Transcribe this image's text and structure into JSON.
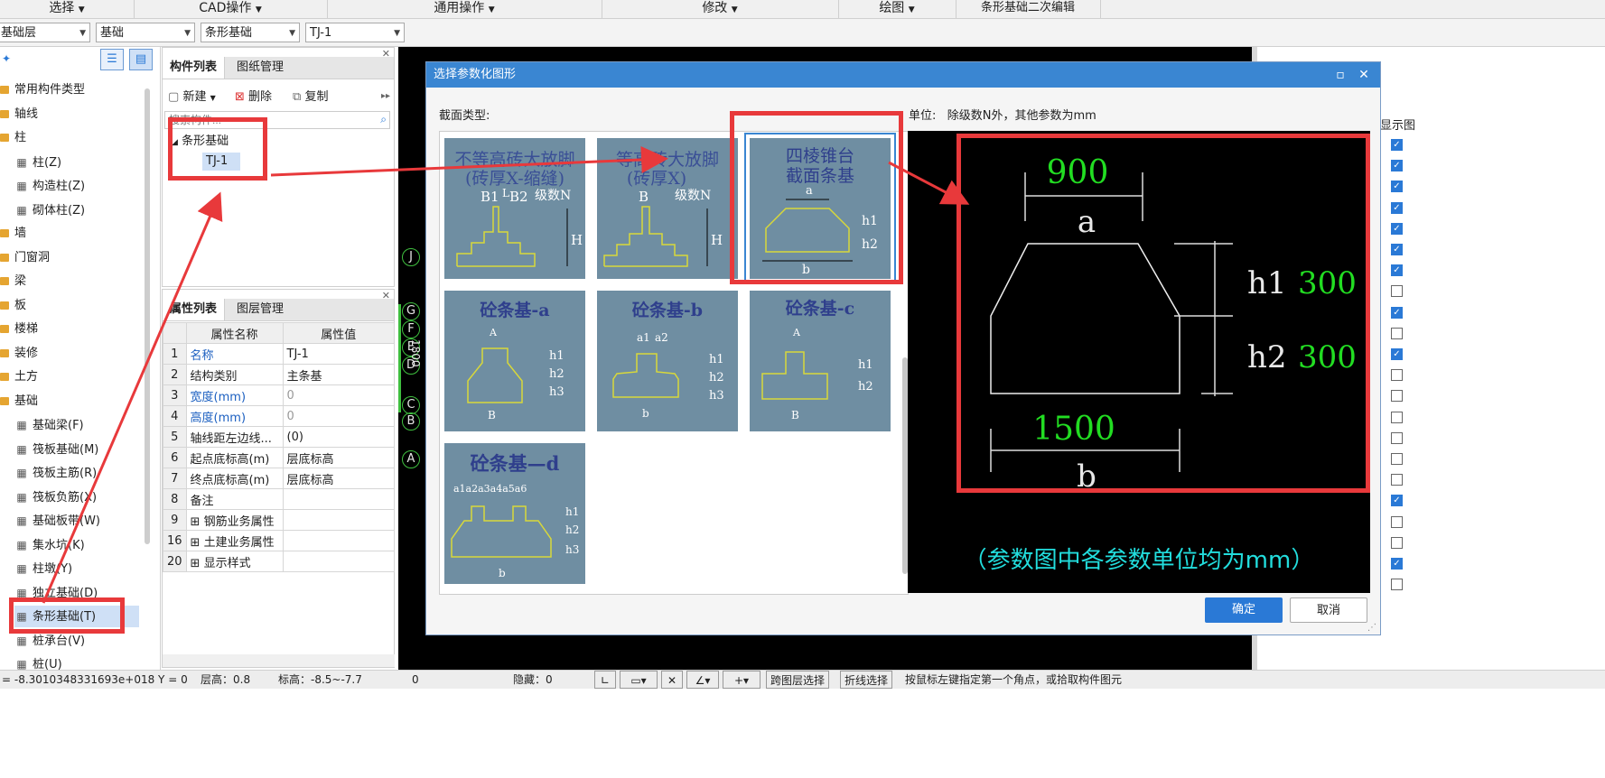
{
  "menu": {
    "items": [
      "选择",
      "CAD操作",
      "通用操作",
      "修改",
      "绘图",
      "条形基础二次编辑"
    ]
  },
  "selectors": {
    "floor": "基础层",
    "category": "基础",
    "type": "条形基础",
    "component": "TJ-1"
  },
  "tree": {
    "items": [
      {
        "label": "常用构件类型",
        "kind": "folder"
      },
      {
        "label": "轴线",
        "kind": "folder"
      },
      {
        "label": "柱",
        "kind": "folder"
      },
      {
        "label": "柱(Z)",
        "kind": "child"
      },
      {
        "label": "构造柱(Z)",
        "kind": "child"
      },
      {
        "label": "砌体柱(Z)",
        "kind": "child"
      },
      {
        "label": "墙",
        "kind": "folder"
      },
      {
        "label": "门窗洞",
        "kind": "folder"
      },
      {
        "label": "梁",
        "kind": "folder"
      },
      {
        "label": "板",
        "kind": "folder"
      },
      {
        "label": "楼梯",
        "kind": "folder"
      },
      {
        "label": "装修",
        "kind": "folder"
      },
      {
        "label": "土方",
        "kind": "folder"
      },
      {
        "label": "基础",
        "kind": "folder"
      },
      {
        "label": "基础梁(F)",
        "kind": "child"
      },
      {
        "label": "筏板基础(M)",
        "kind": "child"
      },
      {
        "label": "筏板主筋(R)",
        "kind": "child"
      },
      {
        "label": "筏板负筋(X)",
        "kind": "child"
      },
      {
        "label": "基础板带(W)",
        "kind": "child"
      },
      {
        "label": "集水坑(K)",
        "kind": "child"
      },
      {
        "label": "柱墩(Y)",
        "kind": "child"
      },
      {
        "label": "独立基础(D)",
        "kind": "child"
      },
      {
        "label": "条形基础(T)",
        "kind": "child"
      },
      {
        "label": "桩承台(V)",
        "kind": "child"
      },
      {
        "label": "桩(U)",
        "kind": "child"
      }
    ]
  },
  "component_panel": {
    "tabs": [
      "构件列表",
      "图纸管理"
    ],
    "new_label": "新建",
    "delete_label": "删除",
    "copy_label": "复制",
    "search_placeholder": "搜索构件...",
    "group": "条形基础",
    "item": "TJ-1"
  },
  "property_panel": {
    "tabs": [
      "属性列表",
      "图层管理"
    ],
    "headers": [
      "属性名称",
      "属性值"
    ],
    "rows": [
      {
        "num": "1",
        "name": "名称",
        "value": "TJ-1",
        "name_blue": true,
        "value_gray": false,
        "expand": false
      },
      {
        "num": "2",
        "name": "结构类别",
        "value": "主条基",
        "name_blue": false,
        "value_gray": false,
        "expand": false
      },
      {
        "num": "3",
        "name": "宽度(mm)",
        "value": "0",
        "name_blue": true,
        "value_gray": true,
        "expand": false
      },
      {
        "num": "4",
        "name": "高度(mm)",
        "value": "0",
        "name_blue": true,
        "value_gray": true,
        "expand": false
      },
      {
        "num": "5",
        "name": "轴线距左边线...",
        "value": "(0)",
        "name_blue": false,
        "value_gray": false,
        "expand": false
      },
      {
        "num": "6",
        "name": "起点底标高(m)",
        "value": "层底标高",
        "name_blue": false,
        "value_gray": false,
        "expand": false
      },
      {
        "num": "7",
        "name": "终点底标高(m)",
        "value": "层底标高",
        "name_blue": false,
        "value_gray": false,
        "expand": false
      },
      {
        "num": "8",
        "name": "备注",
        "value": "",
        "name_blue": false,
        "value_gray": false,
        "expand": false
      },
      {
        "num": "9",
        "name": "钢筋业务属性",
        "value": "",
        "name_blue": false,
        "value_gray": false,
        "expand": true
      },
      {
        "num": "16",
        "name": "土建业务属性",
        "value": "",
        "name_blue": false,
        "value_gray": false,
        "expand": true
      },
      {
        "num": "20",
        "name": "显示样式",
        "value": "",
        "name_blue": false,
        "value_gray": false,
        "expand": true
      }
    ]
  },
  "canvas": {
    "axes": [
      "J",
      "G",
      "F",
      "E",
      "D",
      "C",
      "B",
      "A"
    ],
    "dim_text": "1800"
  },
  "dialog": {
    "title": "选择参数化图形",
    "section_label": "截面类型:",
    "unit_label": "单位:",
    "unit_text": "除级数N外，其他参数为mm",
    "thumbs": [
      {
        "title1": "不等高砖大放脚",
        "title2": "(砖厚X-缩缝)",
        "labels": [
          "B1",
          "L",
          "B2",
          "级数N",
          "H"
        ]
      },
      {
        "title1": "等高砖大放脚",
        "title2": "(砖厚X)",
        "labels": [
          "B",
          "级数N",
          "H"
        ]
      },
      {
        "title1": "四棱锥台",
        "title2": "截面条基",
        "labels": [
          "a",
          "h1",
          "h2",
          "b"
        ]
      },
      {
        "title1": "砼条基-a",
        "labels": [
          "A",
          "h1",
          "h2",
          "h3",
          "B"
        ]
      },
      {
        "title1": "砼条基-b",
        "labels": [
          "a1",
          "a2",
          "h1",
          "h2",
          "h3",
          "b"
        ]
      },
      {
        "title1": "砼条基-c",
        "labels": [
          "A",
          "h1",
          "h2",
          "B"
        ]
      },
      {
        "title1": "砼条基—d",
        "labels": [
          "a1a2a3a4a5a6",
          "h1",
          "h2",
          "h3",
          "b"
        ]
      }
    ],
    "preview": {
      "a_value": "900",
      "a_label": "a",
      "h1_label": "h1",
      "h1_value": "300",
      "h2_label": "h2",
      "h2_value": "300",
      "b_value": "1500",
      "b_label": "b",
      "note": "（参数图中各参数单位均为mm）"
    },
    "ok_label": "确定",
    "cancel_label": "取消"
  },
  "right_panel": {
    "header": "显示图",
    "checks": [
      true,
      true,
      true,
      true,
      true,
      true,
      true,
      false,
      true,
      false,
      true,
      false,
      false,
      false,
      false,
      false,
      false,
      true,
      false,
      false,
      true,
      false
    ]
  },
  "status": {
    "coord": "= -8.3010348331693e+018 Y = 0",
    "floor_height": "层高：0.8",
    "elevation": "标高：-8.5~-7.7",
    "zero": "0",
    "hidden": "隐藏：0",
    "cross_layer": "跨图层选择",
    "polyline": "折线选择",
    "hint": "按鼠标左键指定第一个角点，或拾取构件图元"
  },
  "colors": {
    "accent": "#3a86d2",
    "highlight_red": "#e8393b",
    "cad_green": "#22dd22",
    "cad_cyan": "#22dddd",
    "thumb_bg": "#6f8ea2"
  }
}
